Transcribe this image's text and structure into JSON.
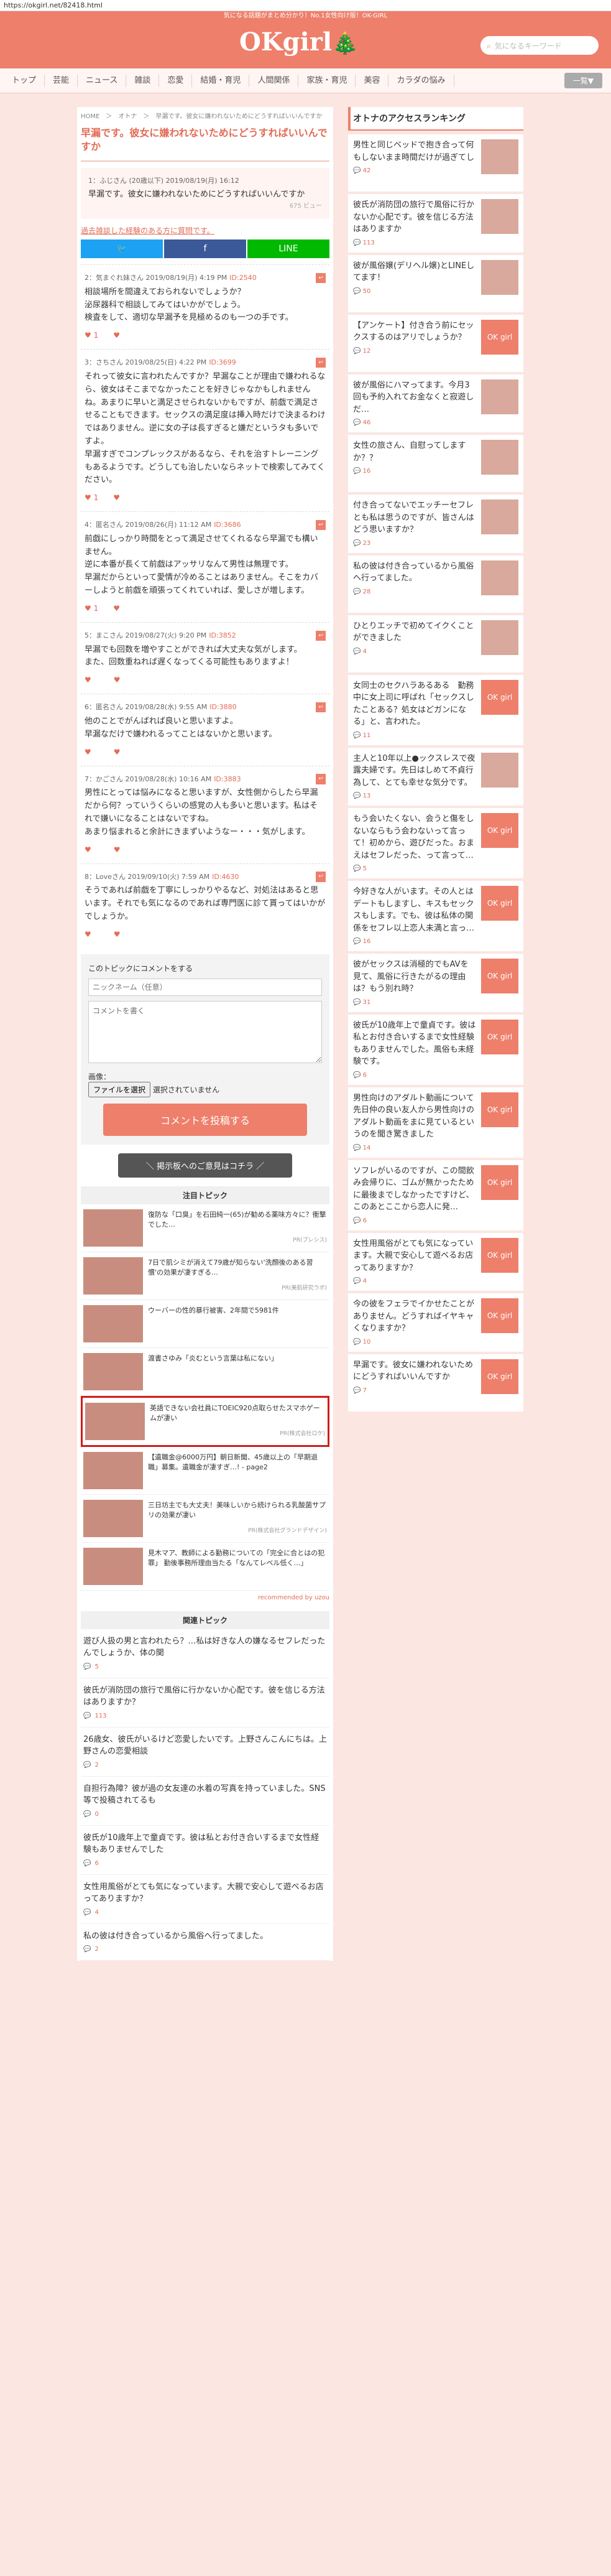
{
  "browser": {
    "url": "https://okgirl.net/82418.html"
  },
  "header": {
    "tagline": "気になる話題がまとめ分かり！No.1女性向け版！OK-GIRL",
    "logo": "OKgirl",
    "logo_tree": "🎄",
    "search_placeholder": "気になるキーワード"
  },
  "nav": {
    "items": [
      "トップ",
      "芸能",
      "ニュース",
      "雑談",
      "恋愛",
      "結婚・育児",
      "人間関係",
      "家族・育児",
      "美容",
      "カラダの悩み"
    ],
    "more": "一覧▼"
  },
  "article": {
    "breadcrumb": "HOME　＞　オトナ　＞　早漏です。彼女に嫌われないためにどうすればいいんですか",
    "title": "早漏です。彼女に嫌われないためにどうすればいいんですか",
    "first": {
      "meta": "1：ふじさん (20歳以下) 2019/08/19(月) 16:12",
      "body": "早漏です。彼女に嫌われないためにどうすればいいんですか",
      "views": "675 ビュー"
    },
    "related_link": "過去雑談した経験のある方に質問です。"
  },
  "share": {
    "twitter": "🐦",
    "facebook": "f",
    "line": "LINE"
  },
  "comments": [
    {
      "meta": "2：気まぐれ妹さん 2019/08/19(月) 4:19 PM",
      "id": "ID:2540",
      "body": "相談場所を間違えておられないでしょうか？\n泌尿器科で相談してみてはいかがでしょう。\n検査をして、適切な早漏予を見極めるのも一つの手です。",
      "likes": "♥ 1　　♥"
    },
    {
      "meta": "3：さちさん 2019/08/25(日) 4:22 PM",
      "id": "ID:3699",
      "body": "それって彼女に言われたんですか？早漏なことが理由で嫌われるなら、彼女はそこまでなかったことを好きじゃなかもしれませんね。あまりに早いと満足させられないかもですが、前戯で満足させることもできます。セックスの満足度は挿入時だけで決まるわけではありません。逆に女の子は長すぎると嫌だというタも多いですよ。\n早漏すぎでコンプレックスがあるなら、それを治すトレーニングもあるようです。どうしても治したいならネットで検索してみてください。",
      "likes": "♥ 1　　♥"
    },
    {
      "meta": "4：匿名さん 2019/08/26(月) 11:12 AM",
      "id": "ID:3686",
      "body": "前戯にしっかり時間をとって満足させてくれるなら早漏でも構いません。\n逆に本番が長くて前戯はアッサリなんて男性は無理です。\n早漏だからといって愛情が冷めることはありません。そこをカバーしようと前戯を頑張ってくれていれば、愛しさが増します。",
      "likes": "♥ 1　　♥"
    },
    {
      "meta": "5：まこさん 2019/08/27(火) 9:20 PM",
      "id": "ID:3852",
      "body": "早漏でも回数を増やすことができれば大丈夫な気がします。\nまた、回数重ねれば遅くなってくる可能性もありますよ！",
      "likes": "♥　　　♥"
    },
    {
      "meta": "6：匿名さん 2019/08/28(水) 9:55 AM",
      "id": "ID:3880",
      "body": "他のことでがんばれば良いと思いますよ。\n早漏なだけで嫌われるってことはないかと思います。",
      "likes": "♥　　　♥"
    },
    {
      "meta": "7：かごさん 2019/08/28(水) 10:16 AM",
      "id": "ID:3883",
      "body": "男性にとっては悩みになると思いますが、女性側からしたら早漏だから何？っていうくらいの感覚の人も多いと思います。私はそれで嫌いになることはないですね。\nあまり悩まれると余計にきまずいようなー・・・気がします。",
      "likes": "♥　　　♥"
    },
    {
      "meta": "8：Loveさん 2019/09/10(火) 7:59 AM",
      "id": "ID:4630",
      "body": "そうであれば前戯を丁寧にしっかりやるなど、対処法はあると思います。それでも気になるのであれば専門医に診て貰ってはいかがでしょうか。",
      "likes": "♥　　　♥"
    }
  ],
  "form": {
    "heading": "このトピックにコメントをする",
    "name_placeholder": "ニックネーム（任意）",
    "comment_placeholder": "コメントを書く",
    "image_label": "画像：",
    "file_button": "ファイルを選択",
    "file_status": "選択されていません",
    "submit": "コメントを投稿する",
    "request": "＼ 掲示板へのご意見はコチラ ／"
  },
  "ads": {
    "heading": "注目トピック",
    "items": [
      {
        "text": "復防な「口臭」を石田純一(65)が勧める薬味方々に？衝撃でした…",
        "source": "PR(プレシス)"
      },
      {
        "text": "7日で肌シミが消えて79歳が知らない'洗顔後のある習慣'の効果が凄すぎる…",
        "source": "PR(美肌研究ラボ)"
      },
      {
        "text": "ウーバーの性的暴行被害、2年間で5981件",
        "source": ""
      },
      {
        "text": "渡書さゆみ「炎むという言葉は私にない」",
        "source": ""
      },
      {
        "text": "英語できない会社員にTOEIC920点取らせたスマホゲームが凄い",
        "source": "PR(株式会社ロケ)"
      },
      {
        "text": "【遺職金@6000万円】朝日新聞、45歳以上の「早期退職」募集。遺職金が凄すぎ…! - page2",
        "source": ""
      },
      {
        "text": "三日坊主でも大丈夫！美味しいから続けられる乳酸菌サプリの効果が凄い",
        "source": "PR(株式会社グランドデザイン)"
      },
      {
        "text": "見木マア、教師による勤務についての「完全に合とはの犯罪」 勤後事務所理由当たる「なんてレベル低く…」",
        "source": ""
      }
    ],
    "recommended": "recommended by uzou"
  },
  "topics": {
    "heading": "関連トピック",
    "items": [
      {
        "text": "遊び人扱の男と言われたら？…私は好きな人の嫌なるセフレだったんでしょうか、体の関",
        "count": "5"
      },
      {
        "text": "彼氏が消防団の旅行で風俗に行かないか心配です。彼を信じる方法はありますか？",
        "count": "113"
      },
      {
        "text": "26歳女、彼氏がいるけど恋愛したいです。上野さんこんにちは。上野さんの恋愛相談",
        "count": "2"
      },
      {
        "text": "自担行為障？彼が過の女友達の水着の写真を持っていました。SNS等で投稿されてるも",
        "count": "0"
      },
      {
        "text": "彼氏が10歳年上で童貞です。彼は私とお付き合いするまで女性経験もありませんでした",
        "count": "6"
      },
      {
        "text": "女性用風俗がとても気になっています。大親で安心して遊べるお店ってありますか？",
        "count": "4"
      },
      {
        "text": "私の彼は付き合っているから風俗へ行ってました。",
        "count": "2"
      }
    ]
  },
  "ranking": {
    "heading": "オトナのアクセスランキング",
    "items": [
      {
        "text": "男性と同じベッドで抱き合って何もしないまま時間だけが過ぎてし",
        "count": "42",
        "image": ""
      },
      {
        "text": "彼氏が消防団の旅行で風俗に行かないか心配です。彼を信じる方法はありますか",
        "count": "113",
        "image": ""
      },
      {
        "text": "彼が風俗嬢(デリヘル嬢)とLINEしてます！",
        "count": "50",
        "image": ""
      },
      {
        "text": "【アンケート】付き合う前にセックスするのはアリでしょうか？",
        "count": "12",
        "image": "OK girl"
      },
      {
        "text": "彼が風俗にハマってます。今月3回も予約入れてお金なくと寂遊しだ…",
        "count": "46",
        "image": ""
      },
      {
        "text": "女性の旅さん、自慰ってしますか？？",
        "count": "16",
        "image": ""
      },
      {
        "text": "付き合ってないでエッチーセフレとも私は思うのですが、皆さんはどう思いますか？",
        "count": "23",
        "image": ""
      },
      {
        "text": "私の彼は付き合っているから風俗へ行ってました。",
        "count": "28",
        "image": ""
      },
      {
        "text": "ひとりエッチで初めてイクくことができました",
        "count": "4",
        "image": ""
      },
      {
        "text": "女同士のセクハラあるある　勤務中に女上司に呼ばれ「セックスしたことある？処女はどガンになる」と、言われた。",
        "count": "11",
        "image": "OK girl"
      },
      {
        "text": "主人と10年以上●ックスレスで夜露夫婦です。先日はしめて不貞行為して、とても幸せな気分です。",
        "count": "13",
        "image": ""
      },
      {
        "text": "もう会いたくない、会うと傷をしないならもう会わないって言って！初めから、遊びだった。おまえはセフレだった、って言って…",
        "count": "5",
        "image": "OK girl"
      },
      {
        "text": "今好きな人がいます。その人とはデートもしますし、キスもセックスもします。でも、彼は私体の関係をセフレ以上恋人未満と言っ…",
        "count": "16",
        "image": "OK girl"
      },
      {
        "text": "彼がセックスは消極的でもAVを見て、風俗に行きたがるの理由は？もう別れ時？",
        "count": "31",
        "image": "OK girl"
      },
      {
        "text": "彼氏が10歳年上で童貞です。彼は私とお付き合いするまで女性経験もありませんでした。風俗も未経験です。",
        "count": "6",
        "image": "OK girl"
      },
      {
        "text": "男性向けのアダルト動画について先日仲の良い友人から男性向けのアダルト動画をまに見ているというのを聞き驚きました",
        "count": "14",
        "image": "OK girl"
      },
      {
        "text": "ソフレがいるのですが、この間飲み会帰りに、ゴムが無かったために最後までしなかったですけど、このあとここから恋人に発…",
        "count": "6",
        "image": "OK girl"
      },
      {
        "text": "女性用風俗がとても気になっています。大親で安心して遊べるお店ってありますか？",
        "count": "4",
        "image": "OK girl"
      },
      {
        "text": "今の彼をフェラでイかせたことがありません。どうすればイヤキャくなりますか？",
        "count": "10",
        "image": "OK girl"
      },
      {
        "text": "早漏です。彼女に嫌われないためにどうすればいいんですか",
        "count": "7",
        "image": "OK girl"
      }
    ]
  },
  "colors": {
    "accent": "#ee7f6b",
    "background": "#fbe6e1",
    "highlight": "#d21b1b"
  }
}
